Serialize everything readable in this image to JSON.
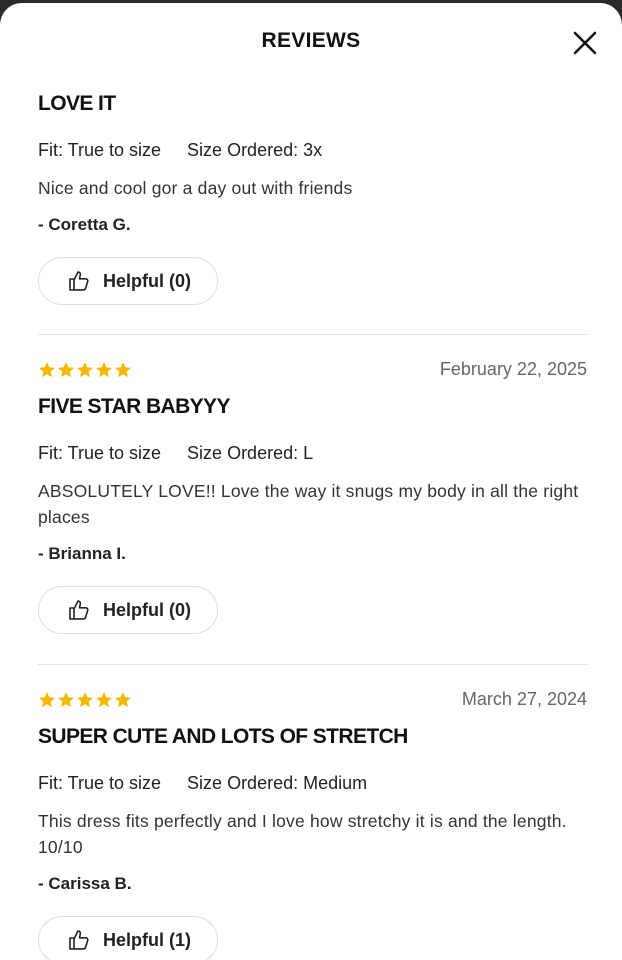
{
  "header": {
    "title": "REVIEWS",
    "close_icon": "close-icon"
  },
  "colors": {
    "star": "#F5B800",
    "divider": "#E2E2E2",
    "date": "#666666"
  },
  "reviews": [
    {
      "rating": null,
      "date": "",
      "title": "LOVE IT",
      "fit_label": "Fit: True to size",
      "size_label": "Size Ordered: 3x",
      "body": "Nice and cool gor a day out with friends",
      "author": "- Coretta G.",
      "helpful_label": "Helpful (0)"
    },
    {
      "rating": 5,
      "date": "February 22, 2025",
      "title": "FIVE STAR BABYYY",
      "fit_label": "Fit: True to size",
      "size_label": "Size Ordered: L",
      "body": "ABSOLUTELY LOVE!! Love the way it snugs my body in all the right places",
      "author": "- Brianna I.",
      "helpful_label": "Helpful (0)"
    },
    {
      "rating": 5,
      "date": "March 27, 2024",
      "title": "SUPER CUTE AND LOTS OF STRETCH",
      "fit_label": "Fit: True to size",
      "size_label": "Size Ordered: Medium",
      "body": "This dress fits perfectly and I love how stretchy it is and the length. 10/10",
      "author": "- Carissa B.",
      "helpful_label": "Helpful (1)"
    }
  ]
}
